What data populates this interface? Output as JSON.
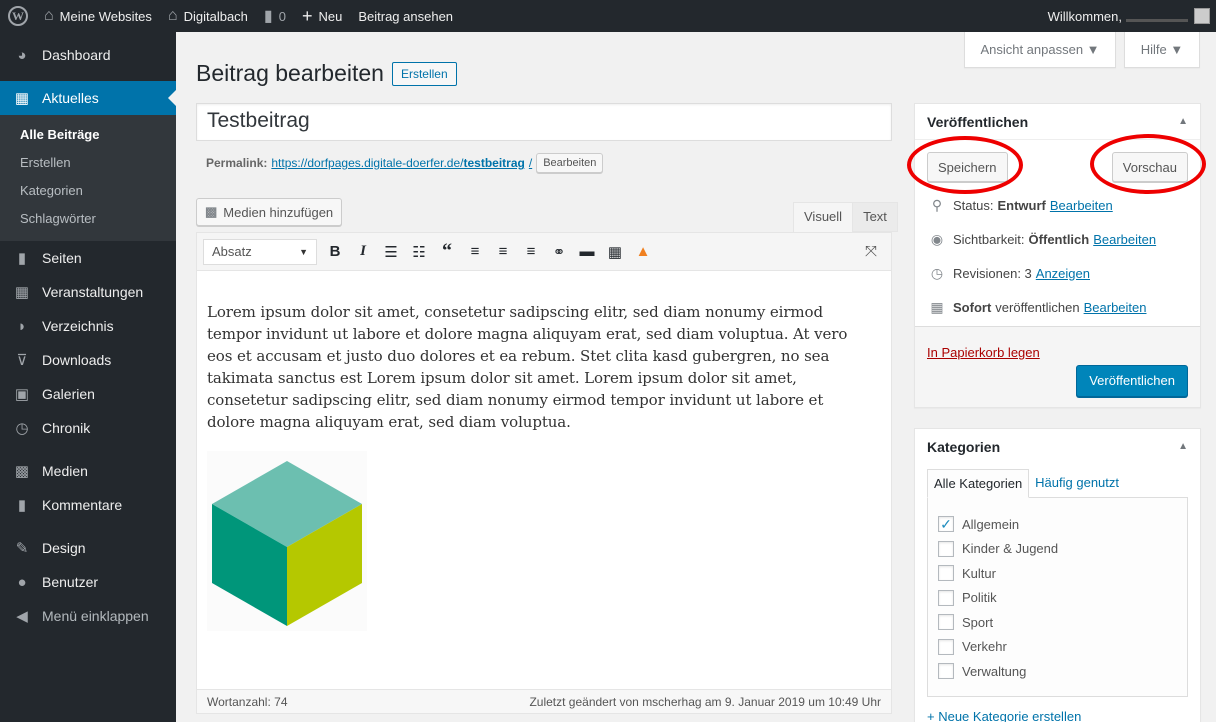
{
  "adminbar": {
    "my_sites": "Meine Websites",
    "site_name": "Digitalbach",
    "comments_count": "0",
    "new_label": "Neu",
    "view_post": "Beitrag ansehen",
    "welcome": "Willkommen,"
  },
  "sidebar": {
    "items": [
      {
        "label": "Dashboard",
        "icon": "dashboard-icon"
      },
      {
        "label": "Aktuelles",
        "icon": "posts-icon"
      },
      {
        "label": "Seiten",
        "icon": "pages-icon"
      },
      {
        "label": "Veranstaltungen",
        "icon": "calendar-icon"
      },
      {
        "label": "Verzeichnis",
        "icon": "directory-icon"
      },
      {
        "label": "Downloads",
        "icon": "download-icon"
      },
      {
        "label": "Galerien",
        "icon": "gallery-icon"
      },
      {
        "label": "Chronik",
        "icon": "history-icon"
      },
      {
        "label": "Medien",
        "icon": "media-icon"
      },
      {
        "label": "Kommentare",
        "icon": "comments-icon"
      },
      {
        "label": "Design",
        "icon": "design-icon"
      },
      {
        "label": "Benutzer",
        "icon": "users-icon"
      },
      {
        "label": "Menü einklappen",
        "icon": "collapse-icon"
      }
    ],
    "submenu": [
      "Alle Beiträge",
      "Erstellen",
      "Kategorien",
      "Schlagwörter"
    ]
  },
  "screen_options": "Ansicht anpassen ▼",
  "help": "Hilfe ▼",
  "page": {
    "title": "Beitrag bearbeiten",
    "add_new": "Erstellen"
  },
  "post": {
    "title": "Testbeitrag",
    "permalink_label": "Permalink:",
    "permalink_base": "https://dorfpages.digitale-doerfer.de/",
    "permalink_slug": "testbeitrag",
    "permalink_end": "/",
    "permalink_edit": "Bearbeiten"
  },
  "editor": {
    "media_button": "Medien hinzufügen",
    "tab_visual": "Visuell",
    "tab_text": "Text",
    "format": "Absatz",
    "content": "Lorem ipsum dolor sit amet, consetetur sadipscing elitr, sed diam nonumy eirmod tempor invidunt ut labore et dolore magna aliquyam erat, sed diam voluptua. At vero eos et accusam et justo duo dolores et ea rebum. Stet clita kasd gubergren, no sea takimata sanctus est Lorem ipsum dolor sit amet. Lorem ipsum dolor sit amet, consetetur sadipscing elitr, sed diam nonumy eirmod tempor invidunt ut labore et dolore magna aliquyam erat, sed diam voluptua.",
    "word_count": "Wortanzahl: 74",
    "last_edited": "Zuletzt geändert von mscherhag am 9. Januar 2019 um 10:49 Uhr"
  },
  "publish": {
    "heading": "Veröffentlichen",
    "save_draft": "Speichern",
    "preview": "Vorschau",
    "status_label": "Status:",
    "status_value": "Entwurf",
    "visibility_label": "Sichtbarkeit:",
    "visibility_value": "Öffentlich",
    "revisions_label": "Revisionen: 3",
    "revisions_link": "Anzeigen",
    "schedule_label": "Sofort",
    "schedule_text": "veröffentlichen",
    "edit_link": "Bearbeiten",
    "trash": "In Papierkorb legen",
    "publish_button": "Veröffentlichen"
  },
  "categories": {
    "heading": "Kategorien",
    "tab_all": "Alle Kategorien",
    "tab_popular": "Häufig genutzt",
    "items": [
      {
        "label": "Allgemein",
        "checked": true
      },
      {
        "label": "Kinder & Jugend",
        "checked": false
      },
      {
        "label": "Kultur",
        "checked": false
      },
      {
        "label": "Politik",
        "checked": false
      },
      {
        "label": "Sport",
        "checked": false
      },
      {
        "label": "Verkehr",
        "checked": false
      },
      {
        "label": "Verwaltung",
        "checked": false
      }
    ],
    "add_new": "+ Neue Kategorie erstellen"
  },
  "colors": {
    "accent": "#0073aa",
    "annotation": "#e00000",
    "cube_top": "#6cbfb0",
    "cube_left": "#00967a",
    "cube_right": "#b5c800"
  }
}
